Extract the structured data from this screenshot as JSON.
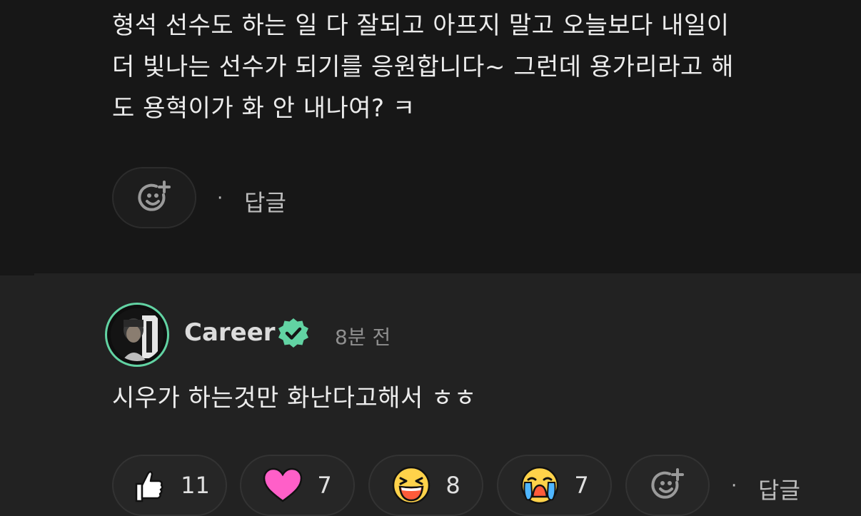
{
  "top_comment": {
    "text": "형석 선수도 하는 일 다 잘되고 아프지 말고 오늘보다 내일이\n더 빛나는 선수가 되기를 응원합니다~ 그런데 용가리라고 해\n도 용혁이가 화 안 내나여? ㅋ",
    "separator": "·",
    "reply_label": "답글"
  },
  "bottom_comment": {
    "username": "Career",
    "time": "8분 전",
    "text": "시우가 하는것만 화난다고해서 ㅎㅎ",
    "separator": "·",
    "reply_label": "답글",
    "reactions": [
      {
        "icon": "thumbs-up-icon",
        "count": "11"
      },
      {
        "icon": "heart-icon",
        "count": "7"
      },
      {
        "icon": "laughing-face-icon",
        "count": "8"
      },
      {
        "icon": "crying-face-icon",
        "count": "7"
      }
    ]
  },
  "colors": {
    "accent_green": "#62d3a3",
    "heart_pink": "#ff5fc8",
    "emoji_yellow": "#ffd24a"
  }
}
